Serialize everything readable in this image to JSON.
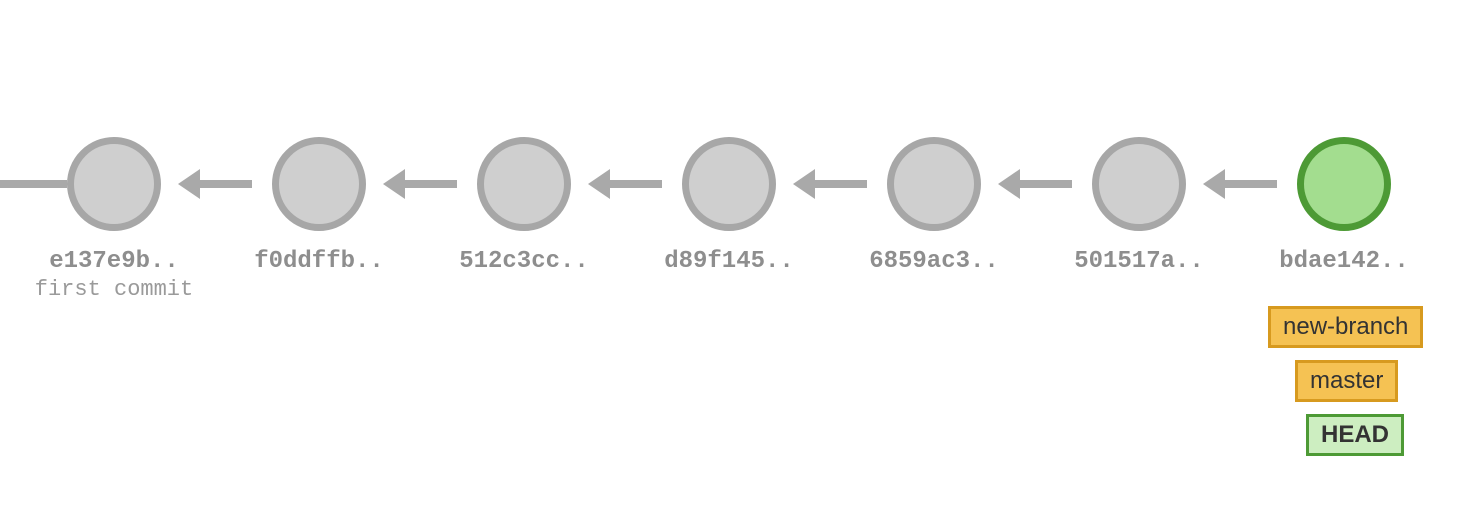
{
  "commits": [
    {
      "hash": "e137e9b..",
      "message": "first commit",
      "head": false
    },
    {
      "hash": "f0ddffb..",
      "message": "",
      "head": false
    },
    {
      "hash": "512c3cc..",
      "message": "",
      "head": false
    },
    {
      "hash": "d89f145..",
      "message": "",
      "head": false
    },
    {
      "hash": "6859ac3..",
      "message": "",
      "head": false
    },
    {
      "hash": "501517a..",
      "message": "",
      "head": false
    },
    {
      "hash": "bdae142..",
      "message": "",
      "head": true
    }
  ],
  "refs": [
    {
      "name": "new-branch",
      "type": "branch"
    },
    {
      "name": "master",
      "type": "branch"
    },
    {
      "name": "HEAD",
      "type": "head"
    }
  ],
  "colors": {
    "commit_fill": "#cfcfcf",
    "commit_stroke": "#a7a7a7",
    "head_fill": "#a3dd8f",
    "head_stroke": "#4d9a35",
    "arrow": "#a9a9a9",
    "branch_fill": "#f5c253",
    "branch_stroke": "#d79a1f",
    "head_tag_fill": "#cdeec1"
  }
}
